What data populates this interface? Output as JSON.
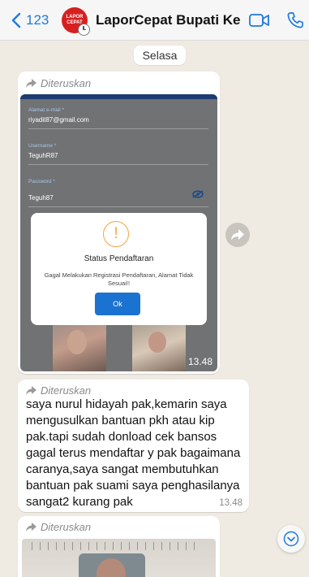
{
  "header": {
    "back_count": "123",
    "avatar_text": "LAPOR CEPAT",
    "title": "LaporCepat Bupati Keb..."
  },
  "chat": {
    "day_label": "Selasa",
    "forwarded_label": "Diteruskan",
    "messages": [
      {
        "type": "image",
        "time": "13.48",
        "screenshot": {
          "fields": [
            {
              "label": "Alamat e-mail *",
              "value": "riyadit87@gmail.com"
            },
            {
              "label": "Username *",
              "value": "TeguhR87"
            },
            {
              "label": "Password *",
              "value": "Teguh87"
            }
          ],
          "dialog": {
            "icon": "!",
            "title": "Status Pendaftaran",
            "message": "Gagal Melakukan Registrasi Pendaftaran, Alamat Tidak Sesuai!!",
            "button": "Ok"
          }
        }
      },
      {
        "type": "text",
        "text": "saya nurul hidayah pak,kemarin saya mengusulkan bantuan pkh  atau kip pak.tapi sudah donload cek bansos gagal terus mendaftar y pak bagaimana caranya,saya sangat membutuhkan bantuan pak suami saya penghasilanya sangat2 kurang pak",
        "time": "13.48"
      },
      {
        "type": "image-partial"
      }
    ]
  },
  "colors": {
    "accent": "#1f7ae0",
    "chat_bg": "#efeae2",
    "bubble": "#ffffff",
    "dialog_button": "#1b73d1",
    "warning": "#f2a640"
  },
  "icons": [
    "chevron-left-icon",
    "video-call-icon",
    "phone-icon",
    "forward-arrow-icon",
    "eye-off-icon",
    "share-forward-icon",
    "chevron-down-circle-icon"
  ]
}
